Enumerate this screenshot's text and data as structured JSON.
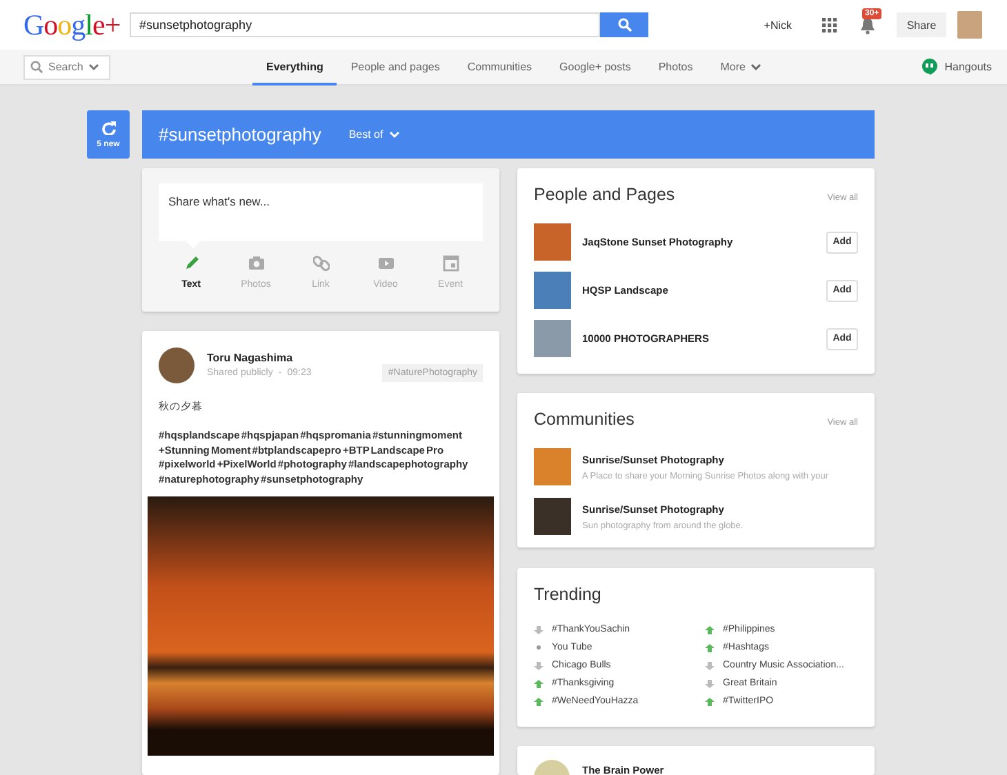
{
  "header": {
    "logo": "Google+",
    "search": {
      "value": "#sunsetphotography"
    },
    "user_link": "+Nick",
    "notification_count": "30+",
    "share_button": "Share"
  },
  "nav": {
    "search_menu": "Search",
    "tabs": [
      {
        "label": "Everything",
        "selected": true
      },
      {
        "label": "People and pages",
        "selected": false
      },
      {
        "label": "Communities",
        "selected": false
      },
      {
        "label": "Google+ posts",
        "selected": false
      },
      {
        "label": "Photos",
        "selected": false
      },
      {
        "label": "More",
        "selected": false
      }
    ],
    "hangouts": "Hangouts"
  },
  "refresh": {
    "label": "5 new"
  },
  "banner": {
    "title": "#sunsetphotography",
    "filter": "Best of"
  },
  "share_box": {
    "placeholder": "Share what's new...",
    "options": [
      {
        "kind": "text",
        "label": "Text",
        "selected": true
      },
      {
        "kind": "photos",
        "label": "Photos",
        "selected": false
      },
      {
        "kind": "link",
        "label": "Link",
        "selected": false
      },
      {
        "kind": "video",
        "label": "Video",
        "selected": false
      },
      {
        "kind": "event",
        "label": "Event",
        "selected": false
      }
    ]
  },
  "post": {
    "author": "Toru Nagashima",
    "visibility": "Shared publicly",
    "separator": "-",
    "time": "09:23",
    "tag": "#NaturePhotography",
    "title": "秋の夕暮",
    "hashtags": "#hqsplandscape  #hqspjapan  #hqspromania  #stunningmoment  +Stunning Moment  #btplandscapepro  +BTP Landscape Pro  #pixelworld  +PixelWorld  #photography  #landscapephotography  #naturephotography  #sunsetphotography"
  },
  "people_and_pages": {
    "title": "People and Pages",
    "view_all": "View all",
    "items": [
      {
        "name": "JaqStone Sunset Photography",
        "button": "Add",
        "color": "#c8642a"
      },
      {
        "name": "HQSP Landscape",
        "button": "Add",
        "color": "#4a7fb8"
      },
      {
        "name": "10000 PHOTOGRAPHERS",
        "button": "Add",
        "color": "#8a9aa8"
      }
    ]
  },
  "communities": {
    "title": "Communities",
    "view_all": "View all",
    "items": [
      {
        "name": "Sunrise/Sunset Photography",
        "description": "A Place to share your Morning Sunrise Photos along with your",
        "color": "#d9822b"
      },
      {
        "name": "Sunrise/Sunset Photography",
        "description": "Sun photography from around the globe.",
        "color": "#3a3028"
      }
    ]
  },
  "trending": {
    "title": "Trending",
    "items": [
      {
        "label": "#ThankYouSachin",
        "kind": "down"
      },
      {
        "label": "You Tube",
        "kind": "steady"
      },
      {
        "label": "Chicago Bulls",
        "kind": "down"
      },
      {
        "label": "#Thanksgiving",
        "kind": "up"
      },
      {
        "label": "#WeNeedYouHazza",
        "kind": "up"
      },
      {
        "label": "#Philippines",
        "kind": "up"
      },
      {
        "label": "#Hashtags",
        "kind": "up"
      },
      {
        "label": "Country Music Association...",
        "kind": "down"
      },
      {
        "label": "Great Britain",
        "kind": "down"
      },
      {
        "label": "#TwitterIPO",
        "kind": "up"
      }
    ]
  },
  "next_card": {
    "name": "The Brain Power"
  }
}
